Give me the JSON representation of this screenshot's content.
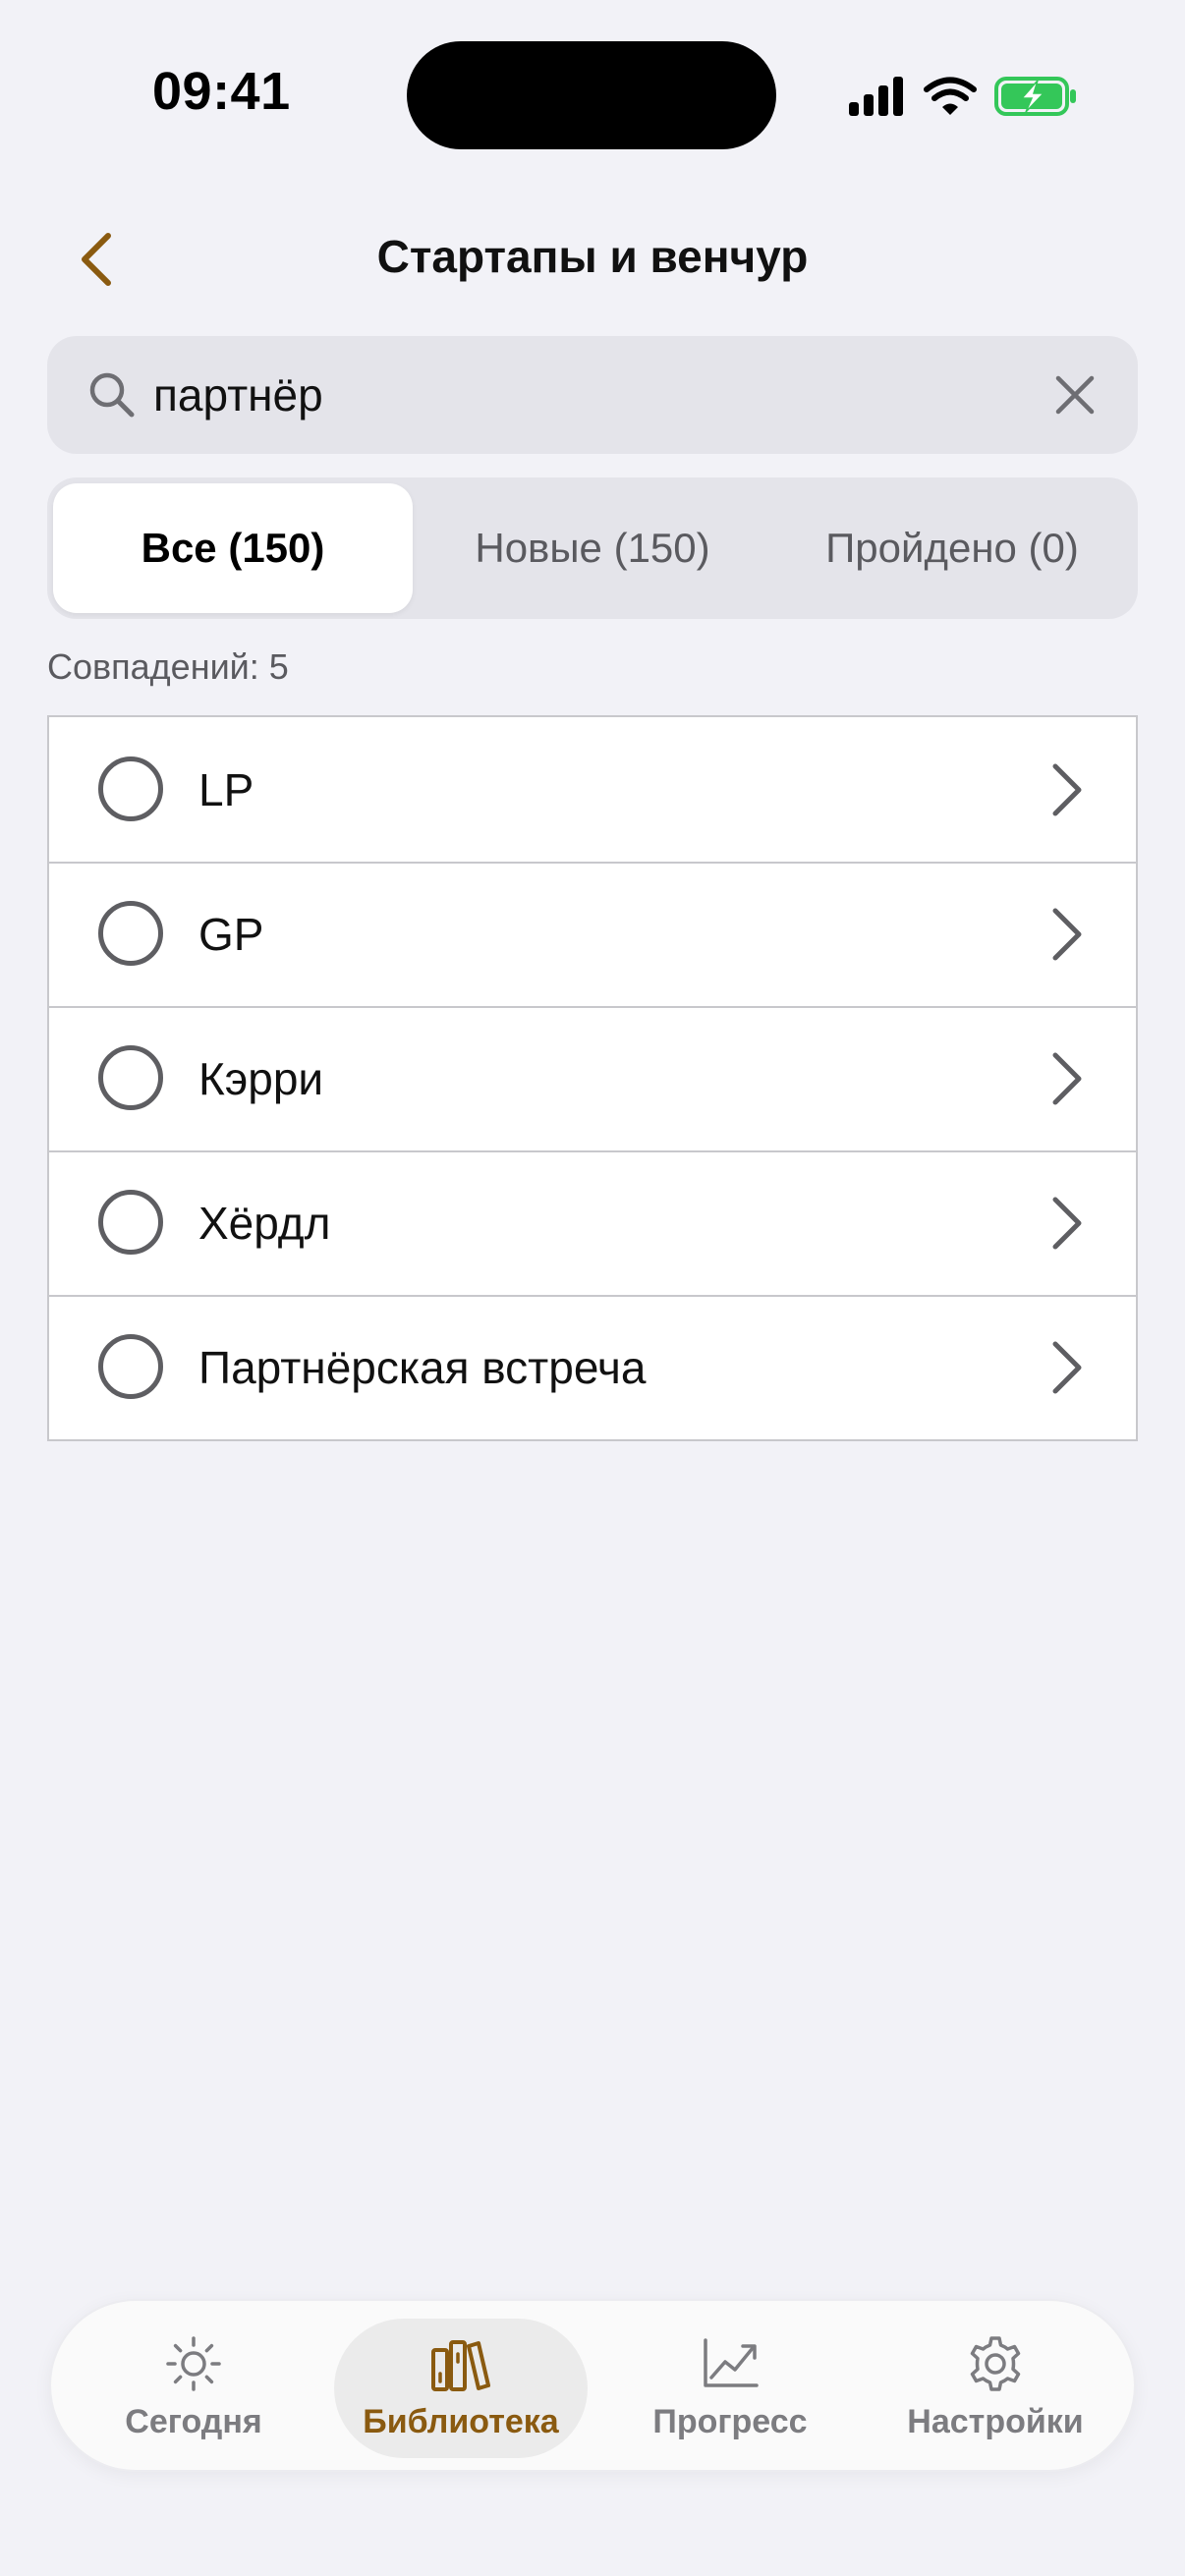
{
  "status": {
    "time": "09:41"
  },
  "header": {
    "title": "Стартапы и венчур"
  },
  "search": {
    "value": "партнёр",
    "placeholder": "Поиск"
  },
  "segments": [
    {
      "label": "Все (150)",
      "active": true
    },
    {
      "label": "Новые (150)",
      "active": false
    },
    {
      "label": "Пройдено (0)",
      "active": false
    }
  ],
  "matches_text": "Совпадений: 5",
  "items": [
    {
      "label": "LP"
    },
    {
      "label": "GP"
    },
    {
      "label": "Кэрри"
    },
    {
      "label": "Хёрдл"
    },
    {
      "label": "Партнёрская встреча"
    }
  ],
  "tabbar": {
    "tabs": [
      {
        "label": "Сегодня",
        "icon": "sun-icon"
      },
      {
        "label": "Библиотека",
        "icon": "books-icon",
        "active": true
      },
      {
        "label": "Прогресс",
        "icon": "chart-icon"
      },
      {
        "label": "Настройки",
        "icon": "gear-icon"
      }
    ]
  },
  "colors": {
    "accent": "#8a5a10",
    "background": "#f2f2f7",
    "battery": "#34c759"
  }
}
